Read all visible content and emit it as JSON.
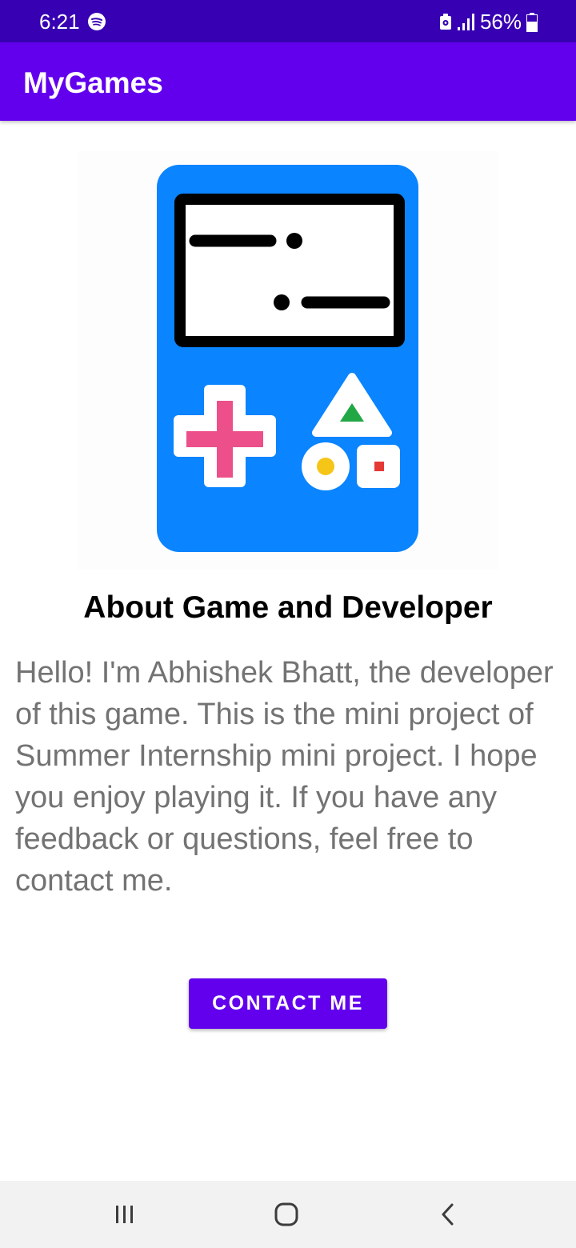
{
  "status_bar": {
    "time": "6:21",
    "battery": "56%",
    "icons": [
      "spotify-icon",
      "data-saver-icon",
      "signal-icon",
      "battery-icon"
    ]
  },
  "app_bar": {
    "title": "MyGames"
  },
  "hero": {
    "icon": "handheld-game-console-icon"
  },
  "content": {
    "heading": "About Game and Developer",
    "body": "Hello! I'm Abhishek Bhatt, the developer of this game. This is the mini project of Summer Internship mini project. I hope you enjoy playing it. If you have any feedback or questions, feel free to contact me."
  },
  "actions": {
    "contact_label": "CONTACT ME"
  },
  "nav_bar": {
    "icons": [
      "recents-icon",
      "home-icon",
      "back-icon"
    ]
  },
  "colors": {
    "status_bar": "#3700b3",
    "primary": "#6200ee",
    "console_blue": "#0a84ff",
    "dpad_pink": "#ec4f8a",
    "triangle_green": "#22a745",
    "circle_yellow": "#f5c518",
    "square_red": "#e53935",
    "body_text": "#737373"
  }
}
